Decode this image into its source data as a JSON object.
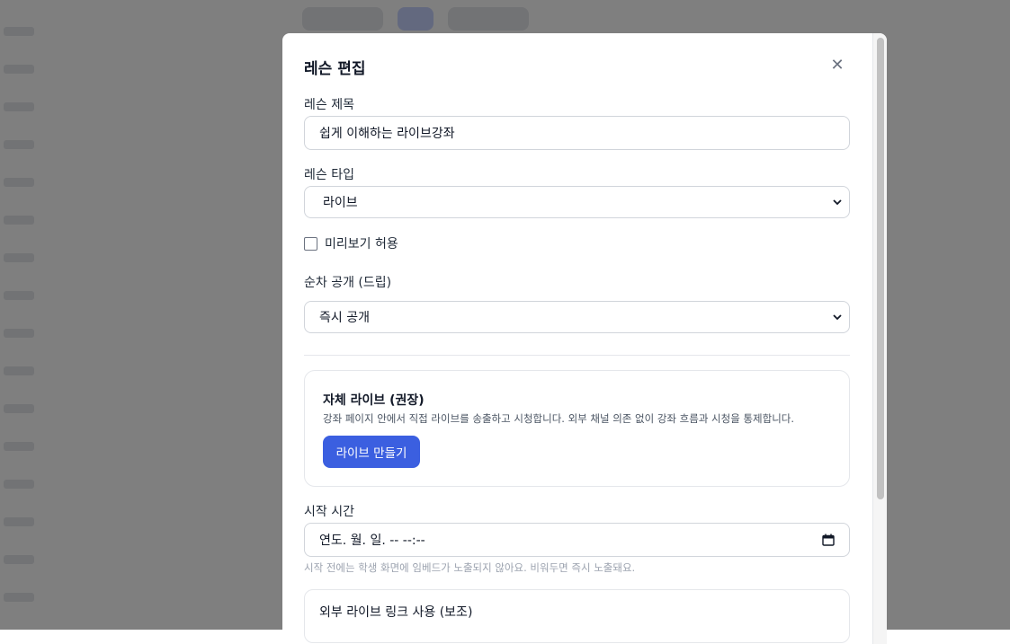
{
  "background": {
    "tabs": [
      "",
      "",
      ""
    ]
  },
  "modal": {
    "title": "레슨 편집",
    "close_icon": "close-icon",
    "lesson_title": {
      "label": "레슨 제목",
      "value": "쉽게 이해하는 라이브강좌"
    },
    "lesson_type": {
      "label": "레슨 타입",
      "value": "라이브"
    },
    "preview": {
      "label": "미리보기 허용",
      "checked": false
    },
    "drip": {
      "label": "순차 공개 (드립)",
      "value": "즉시 공개"
    },
    "live_card": {
      "title": "자체 라이브 (권장)",
      "description": "강좌 페이지 안에서 직접 라이브를 송출하고 시청합니다. 외부 채널 의존 없이 강좌 흐름과 시청을 통제합니다.",
      "button": "라이브 만들기"
    },
    "start_time": {
      "label": "시작 시간",
      "value": "연도. 월. 일. -- --:--",
      "hint": "시작 전에는 학생 화면에 임베드가 노출되지 않아요. 비워두면 즉시 노출돼요."
    },
    "external_link": {
      "label": "외부 라이브 링크 사용 (보조)"
    }
  },
  "colors": {
    "primary": "#3b5fe0",
    "overlay": "rgba(0,0,0,0.5)"
  }
}
